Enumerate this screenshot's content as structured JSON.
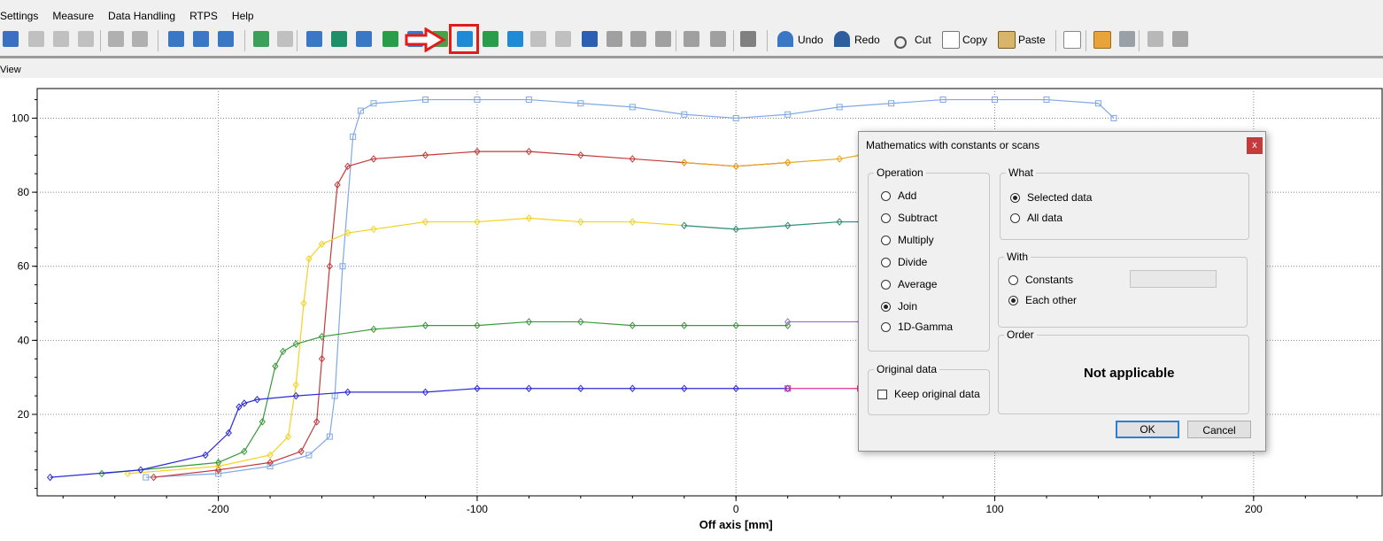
{
  "menu": [
    "Settings",
    "Measure",
    "Data Handling",
    "RTPS",
    "Help"
  ],
  "toolbar": {
    "undo_label": "Undo",
    "redo_label": "Redo",
    "cut_label": "Cut",
    "copy_label": "Copy",
    "paste_label": "Paste",
    "icons": [
      "profile-icon",
      "film-icon",
      "3d-icon",
      "xp-icon",
      "frame-icon",
      "frame-icon",
      "scan-icon",
      "scan-icon",
      "scan-icon",
      "recycle-icon",
      "bd-icon",
      "graph-icon",
      "graph-icon",
      "graph-icon",
      "graph-icon",
      "graph-icon",
      "graph-icon",
      "join-math-icon",
      "table-icon",
      "graph-icon",
      "play-icon",
      "play-icon",
      "calculator-icon",
      "calc-icon",
      "calc-icon",
      "calc-icon",
      "tool-icon",
      "tool-icon",
      "gear-icon"
    ],
    "highlight_color": "#e21b1b"
  },
  "view_label": "View",
  "chart_data": {
    "type": "line",
    "xlabel": "Off axis [mm]",
    "ylabel": "",
    "xlim": [
      -270,
      250
    ],
    "ylim": [
      -2,
      108
    ],
    "xticks": [
      -200,
      -100,
      0,
      100,
      200
    ],
    "yticks": [
      20,
      40,
      60,
      80,
      100
    ],
    "grid": true,
    "series": [
      {
        "color": "#7fa8e6",
        "marker": "square",
        "x": [
          -228,
          -200,
          -180,
          -165,
          -157,
          -155,
          -152,
          -148,
          -145,
          -140,
          -120,
          -100,
          -80,
          -60,
          -40,
          -20,
          0,
          20,
          40,
          60,
          80,
          100,
          120,
          140,
          146
        ],
        "y": [
          3,
          4,
          6,
          9,
          14,
          25,
          60,
          95,
          102,
          104,
          105,
          105,
          105,
          104,
          103,
          101,
          100,
          101,
          103,
          104,
          105,
          105,
          105,
          104,
          100
        ]
      },
      {
        "color": "#c43a3a",
        "marker": "diamond",
        "x": [
          -225,
          -200,
          -180,
          -168,
          -162,
          -160,
          -157,
          -154,
          -150,
          -140,
          -120,
          -100,
          -80,
          -60,
          -40,
          -20,
          0,
          20
        ],
        "y": [
          3,
          5,
          7,
          10,
          18,
          35,
          60,
          82,
          87,
          89,
          90,
          91,
          91,
          90,
          89,
          88,
          87,
          88
        ]
      },
      {
        "color": "#f3d221",
        "marker": "diamond",
        "x": [
          -235,
          -200,
          -180,
          -173,
          -170,
          -167,
          -165,
          -160,
          -150,
          -140,
          -120,
          -100,
          -80,
          -60,
          -40,
          -20,
          0,
          20,
          40
        ],
        "y": [
          4,
          6,
          9,
          14,
          28,
          50,
          62,
          66,
          69,
          70,
          72,
          72,
          73,
          72,
          72,
          71,
          70,
          71,
          72
        ]
      },
      {
        "color": "#3a9a3a",
        "marker": "diamond",
        "x": [
          -245,
          -200,
          -190,
          -183,
          -178,
          -175,
          -170,
          -160,
          -140,
          -120,
          -100,
          -80,
          -60,
          -40,
          -20,
          0,
          20
        ],
        "y": [
          4,
          7,
          10,
          18,
          33,
          37,
          39,
          41,
          43,
          44,
          44,
          45,
          45,
          44,
          44,
          44,
          44
        ]
      },
      {
        "color": "#2b2bd6",
        "marker": "diamond",
        "x": [
          -265,
          -230,
          -205,
          -196,
          -192,
          -190,
          -185,
          -170,
          -150,
          -120,
          -100,
          -80,
          -60,
          -40,
          -20,
          0,
          20
        ],
        "y": [
          3,
          5,
          9,
          15,
          22,
          23,
          24,
          25,
          26,
          26,
          27,
          27,
          27,
          27,
          27,
          27,
          27
        ]
      },
      {
        "color": "#e8a820",
        "marker": "diamond",
        "x": [
          -20,
          0,
          20,
          40,
          48
        ],
        "y": [
          88,
          87,
          88,
          89,
          90
        ]
      },
      {
        "color": "#2a8f8f",
        "marker": "diamond",
        "x": [
          -20,
          0,
          20,
          40,
          48
        ],
        "y": [
          71,
          70,
          71,
          72,
          72
        ]
      },
      {
        "color": "#9a6cd6",
        "marker": "diamond",
        "x": [
          20,
          48
        ],
        "y": [
          45,
          45
        ]
      },
      {
        "color": "#e0308f",
        "marker": "square",
        "x": [
          20,
          48
        ],
        "y": [
          27,
          27
        ]
      }
    ]
  },
  "dialog": {
    "title": "Mathematics with constants or scans",
    "close": "x",
    "operation": {
      "legend": "Operation",
      "options": [
        "Add",
        "Subtract",
        "Multiply",
        "Divide",
        "Average",
        "Join",
        "1D-Gamma"
      ],
      "selected": "Join"
    },
    "original": {
      "legend": "Original data",
      "keep_label": "Keep original data",
      "keep_checked": false
    },
    "what": {
      "legend": "What",
      "options": [
        "Selected data",
        "All data"
      ],
      "selected": "Selected data"
    },
    "with": {
      "legend": "With",
      "options": [
        "Constants",
        "Each other"
      ],
      "selected": "Each other"
    },
    "order": {
      "legend": "Order",
      "value": "Not applicable"
    },
    "ok": "OK",
    "cancel": "Cancel"
  }
}
